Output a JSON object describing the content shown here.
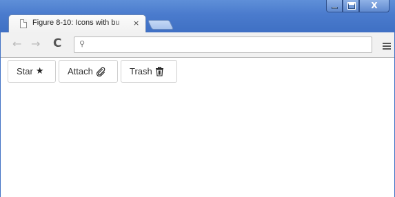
{
  "window": {
    "tab_title": "Figure 8-10: Icons with bu",
    "tab_close": "×",
    "controls": {
      "minimize": "minimize-icon",
      "maximize": "maximize-icon",
      "close_label": "X"
    },
    "accent": "#4a7bcd"
  },
  "toolbar": {
    "back_glyph": "←",
    "forward_glyph": "→",
    "reload_glyph": "C",
    "search_glyph": "⚲",
    "address_value": "",
    "address_placeholder": ""
  },
  "page": {
    "buttons": [
      {
        "label": "Star",
        "icon": "star-icon",
        "glyph": "★"
      },
      {
        "label": "Attach",
        "icon": "paperclip-icon",
        "glyph": "📎"
      },
      {
        "label": "Trash",
        "icon": "trash-icon",
        "glyph": "🗑"
      }
    ]
  }
}
